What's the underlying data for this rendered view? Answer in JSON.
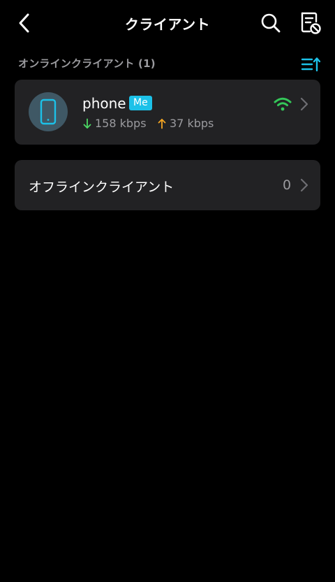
{
  "header": {
    "title": "クライアント"
  },
  "online_section": {
    "label": "オンラインクライアント (1)"
  },
  "clients": [
    {
      "name": "phone",
      "badge": "Me",
      "download_rate": "158 kbps",
      "upload_rate": "37 kbps",
      "icon": "phone-icon",
      "signal_icon": "wifi-icon"
    }
  ],
  "offline_section": {
    "label": "オフラインクライアント",
    "count": "0"
  },
  "colors": {
    "background": "#000000",
    "card": "#222224",
    "accent": "#1cc1e8",
    "download": "#4cd964",
    "upload": "#f5a623",
    "signal": "#34c759",
    "secondary_text": "#9b9b9f"
  }
}
